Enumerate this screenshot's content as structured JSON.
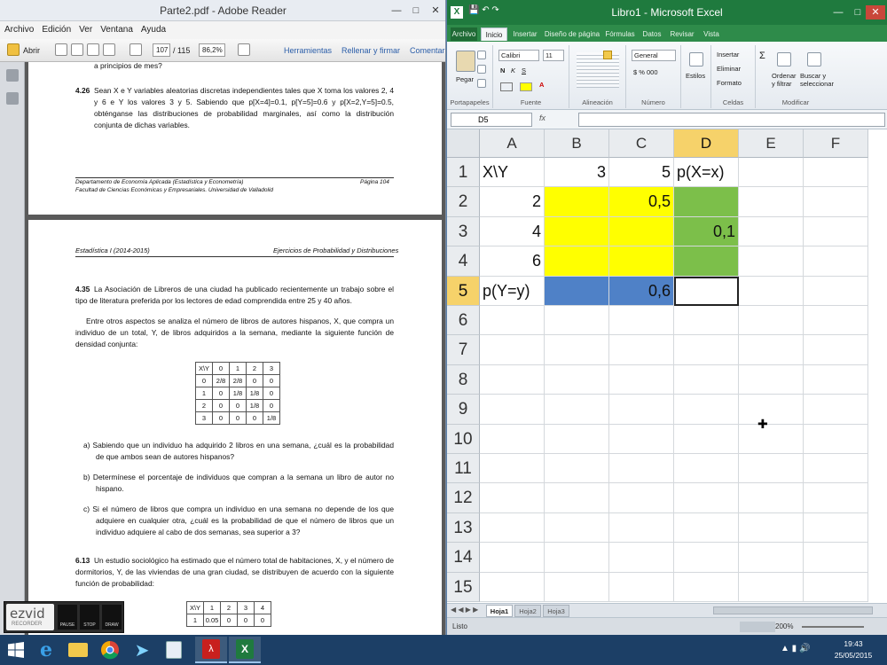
{
  "reader": {
    "title": "Parte2.pdf - Adobe Reader",
    "menu": [
      "Archivo",
      "Edición",
      "Ver",
      "Ventana",
      "Ayuda"
    ],
    "toolbar": {
      "open_label": "Abrir",
      "page_current": "107",
      "page_total": "/ 115",
      "zoom": "86,2%",
      "tools_label": "Herramientas",
      "sign_label": "Rellenar y firmar",
      "comment_label": "Comentar"
    },
    "page1": {
      "top_line": "a principios de mes?",
      "q426_num": "4.26",
      "q426_text": "Sean X e Y variables aleatorias discretas independientes tales que X toma los valores 2, 4 y 6 e Y los valores 3 y 5. Sabiendo que p[X=4]=0.1, p[Y=5]=0.6 y p[X=2,Y=5]=0.5, obténganse las distribuciones de probabilidad marginales, así como la distribución conjunta de dichas variables.",
      "footer_left1": "Departamento de Economía Aplicada (Estadística y Econometría)",
      "footer_left2": "Facultad de Ciencias Económicas y Empresariales. Universidad de Valladolid",
      "footer_right": "Página 104"
    },
    "page2": {
      "header_left": "Estadística I (2014-2015)",
      "header_right": "Ejercicios de Probabilidad y Distribuciones",
      "q435_num": "4.35",
      "q435_text": "La Asociación de Libreros de una ciudad ha publicado recientemente un trabajo sobre el tipo de literatura preferida por los lectores de edad comprendida entre 25 y 40 años.",
      "p2_text": "Entre otros aspectos se analiza el número de libros de autores hispanos, X, que compra un individuo de un total, Y, de libros adquiridos a la semana, mediante la siguiente función de densidad conjunta:",
      "table1": {
        "header": [
          "X\\Y",
          "0",
          "1",
          "2",
          "3"
        ],
        "rows": [
          [
            "0",
            "2/8",
            "2/8",
            "0",
            "0"
          ],
          [
            "1",
            "0",
            "1/8",
            "1/8",
            "0"
          ],
          [
            "2",
            "0",
            "0",
            "1/8",
            "0"
          ],
          [
            "3",
            "0",
            "0",
            "0",
            "1/8"
          ]
        ]
      },
      "item_a": "a)  Sabiendo que un individuo ha adquirido 2 libros en una semana, ¿cuál es la probabilidad de que ambos sean de autores hispanos?",
      "item_b": "b)  Determínese el porcentaje de individuos que compran a la semana un libro de autor no hispano.",
      "item_c": "c)  Si el número de libros que compra un individuo en una semana no depende de los que adquiere en cualquier otra, ¿cuál es la probabilidad de que el número de libros que un individuo adquiere al cabo de dos semanas, sea superior a 3?",
      "q613_num": "6.13",
      "q613_text": "Un estudio sociológico ha estimado que el número total de habitaciones, X, y el número de dormitorios, Y, de las viviendas de una gran ciudad, se distribuyen de acuerdo con la siguiente función de probabilidad:",
      "table2": {
        "header": [
          "X\\Y",
          "1",
          "2",
          "3",
          "4"
        ],
        "row1": [
          "1",
          "0.05",
          "0",
          "0",
          "0"
        ]
      }
    },
    "ezvid": {
      "logo": "ezvid",
      "sub": "RECORDER",
      "btn1": "PAUSE",
      "btn2": "STOP",
      "btn3": "DRAW"
    }
  },
  "excel": {
    "title": "Libro1 - Microsoft Excel",
    "tabs": [
      "Archivo",
      "Inicio",
      "Insertar",
      "Diseño de página",
      "Fórmulas",
      "Datos",
      "Revisar",
      "Vista"
    ],
    "active_tab": "Inicio",
    "ribbon": {
      "paste": "Pegar",
      "font_name": "Calibri",
      "font_size": "11",
      "number_format": "General",
      "styles_label": "Estilos",
      "insert": "Insertar",
      "delete": "Eliminar",
      "format": "Formato",
      "sort_filter": "Ordenar y filtrar",
      "find_select": "Buscar y seleccionar",
      "group_clipboard": "Portapapeles",
      "group_font": "Fuente",
      "group_alignment": "Alineación",
      "group_number": "Número",
      "group_cells": "Celdas",
      "group_editing": "Modificar"
    },
    "name_box": "D5",
    "fx": "fx",
    "columns": [
      "A",
      "B",
      "C",
      "D",
      "E",
      "F"
    ],
    "rows": [
      "1",
      "2",
      "3",
      "4",
      "5",
      "6",
      "7",
      "8",
      "9",
      "10",
      "11",
      "12",
      "13",
      "14",
      "15"
    ],
    "cells": {
      "A1": "X\\Y",
      "B1": "3",
      "C1": "5",
      "D1": "p(X=x)",
      "A2": "2",
      "C2": "0,5",
      "A3": "4",
      "D3": "0,1",
      "A4": "6",
      "A5": "p(Y=y)",
      "C5": "0,6"
    },
    "sheets": [
      "Hoja1",
      "Hoja2",
      "Hoja3"
    ],
    "status": "Listo",
    "zoom": "200%",
    "colors": {
      "yellow": "#ffff00",
      "green": "#7cbf4a",
      "blue": "#4f81c7"
    }
  },
  "taskbar": {
    "time": "19:43",
    "date": "25/05/2015",
    "apps": [
      "windows-start-icon",
      "ie-icon",
      "explorer-icon",
      "chrome-icon",
      "paper-plane-icon",
      "app-icon",
      "acrobat-icon",
      "excel-icon"
    ]
  }
}
